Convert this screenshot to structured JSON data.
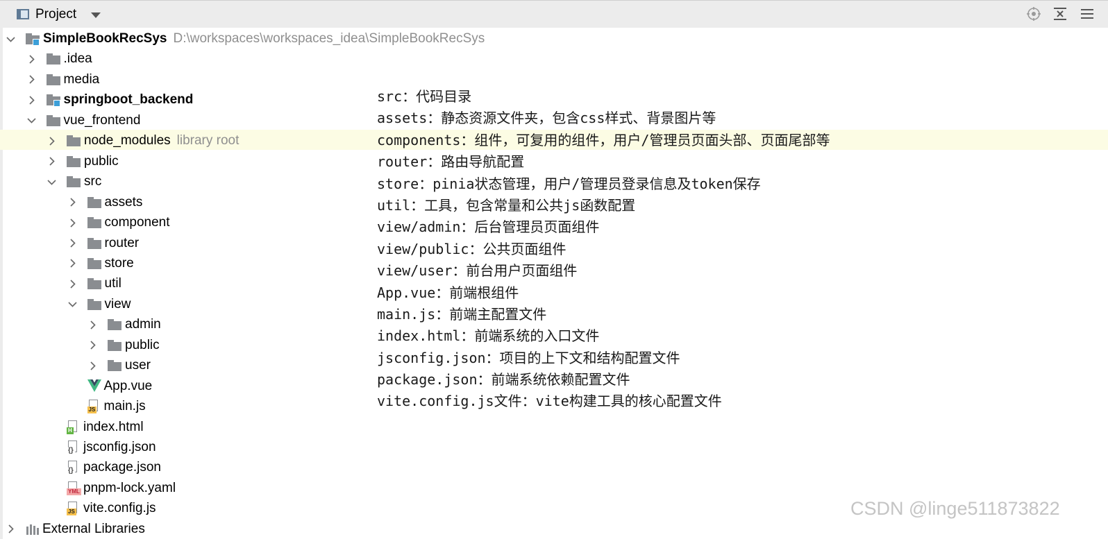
{
  "toolbar": {
    "title": "Project",
    "buttons": [
      "locate-icon",
      "collapse-all-icon",
      "settings-icon"
    ]
  },
  "tree": {
    "root": {
      "name": "SimpleBookRecSys",
      "path": "D:\\workspaces\\workspaces_idea\\SimpleBookRecSys"
    },
    "items": [
      {
        "label": "SimpleBookRecSys",
        "level": 0,
        "expanded": true,
        "type": "module",
        "bold": true,
        "extra": "D:\\workspaces\\workspaces_idea\\SimpleBookRecSys"
      },
      {
        "label": ".idea",
        "level": 1,
        "expanded": false,
        "type": "folder"
      },
      {
        "label": "media",
        "level": 1,
        "expanded": false,
        "type": "folder"
      },
      {
        "label": "springboot_backend",
        "level": 1,
        "expanded": false,
        "type": "module",
        "bold": true
      },
      {
        "label": "vue_frontend",
        "level": 1,
        "expanded": true,
        "type": "folder"
      },
      {
        "label": "node_modules",
        "level": 2,
        "expanded": false,
        "type": "folder",
        "extra": "library root"
      },
      {
        "label": "public",
        "level": 2,
        "expanded": false,
        "type": "folder"
      },
      {
        "label": "src",
        "level": 2,
        "expanded": true,
        "type": "folder"
      },
      {
        "label": "assets",
        "level": 3,
        "expanded": false,
        "type": "folder"
      },
      {
        "label": "component",
        "level": 3,
        "expanded": false,
        "type": "folder"
      },
      {
        "label": "router",
        "level": 3,
        "expanded": false,
        "type": "folder"
      },
      {
        "label": "store",
        "level": 3,
        "expanded": false,
        "type": "folder"
      },
      {
        "label": "util",
        "level": 3,
        "expanded": false,
        "type": "folder"
      },
      {
        "label": "view",
        "level": 3,
        "expanded": true,
        "type": "folder"
      },
      {
        "label": "admin",
        "level": 4,
        "expanded": false,
        "type": "folder"
      },
      {
        "label": "public",
        "level": 4,
        "expanded": false,
        "type": "folder"
      },
      {
        "label": "user",
        "level": 4,
        "expanded": false,
        "type": "folder"
      },
      {
        "label": "App.vue",
        "level": 3,
        "type": "vue"
      },
      {
        "label": "main.js",
        "level": 3,
        "type": "js"
      },
      {
        "label": "index.html",
        "level": 2,
        "type": "html"
      },
      {
        "label": "jsconfig.json",
        "level": 2,
        "type": "json"
      },
      {
        "label": "package.json",
        "level": 2,
        "type": "json"
      },
      {
        "label": "pnpm-lock.yaml",
        "level": 2,
        "type": "yml"
      },
      {
        "label": "vite.config.js",
        "level": 2,
        "type": "js"
      },
      {
        "label": "External Libraries",
        "level": 0,
        "type": "libs"
      }
    ]
  },
  "notes": [
    "src：代码目录",
    "assets：静态资源文件夹，包含css样式、背景图片等",
    "components：组件，可复用的组件，用户/管理员页面头部、页面尾部等",
    "router：路由导航配置",
    "store：pinia状态管理，用户/管理员登录信息及token保存",
    "util：工具，包含常量和公共js函数配置",
    "view/admin：后台管理员页面组件",
    "view/public：公共页面组件",
    "view/user：前台用户页面组件",
    "App.vue：前端根组件",
    "main.js：前端主配置文件",
    "index.html：前端系统的入口文件",
    "jsconfig.json：项目的上下文和结构配置文件",
    "package.json：前端系统依赖配置文件",
    "vite.config.js文件：vite构建工具的核心配置文件"
  ],
  "watermark": "CSDN @linge511873822",
  "colors": {
    "module_badge": "#3d9fd8",
    "folder": "#8a8d91",
    "highlight": "#fcfce4",
    "vue_green": "#41b883"
  }
}
